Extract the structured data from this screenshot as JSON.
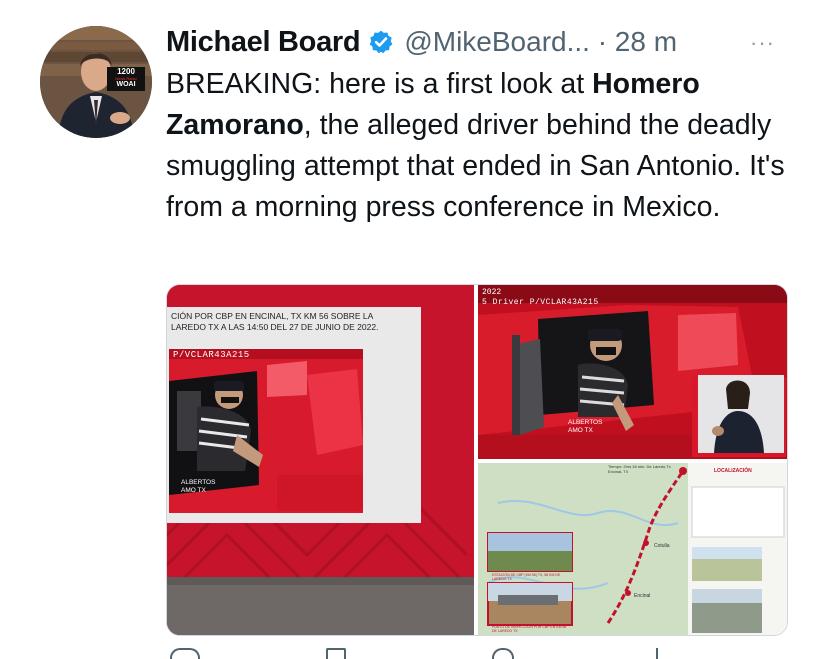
{
  "tweet": {
    "author_name": "Michael Board",
    "handle_time": "@MikeBoard... · 28 m",
    "more_glyph": "···",
    "text_part1": "BREAKING: here is a first look at ",
    "text_bold1": "Homero Zamorano",
    "text_part2": ", the alleged driver behind the deadly smuggling attempt that ended in San Antonio. It's from a morning press conference in Mexico."
  },
  "avatar": {
    "badge_line1": "1200",
    "badge_line2": "News Radio",
    "badge_line3": "WOAI"
  },
  "media": {
    "image1": {
      "caption_line1": "CIÓN POR CBP EN ENCINAL, TX KM 56 SOBRE LA",
      "caption_line2": "LAREDO TX A LAS 14:50 DEL 27 DE JUNIO DE 2022.",
      "plate_text": "P/VCLAR43A215",
      "door_text": "ALBERTOS",
      "door_text2": "AMO TX"
    },
    "image2": {
      "year_text": "2022",
      "overlay_text": "5 Driver P/VCLAR43A215",
      "door_text": "ALBERTOS",
      "door_text2": "AMO TX"
    },
    "image3": {
      "header_text": "Tiempo: 2hrs 16 min. De Laredo,Tx",
      "header_text2": "Encinal, TX",
      "loc_text": "LOCALIZACIÓN",
      "caption_a": "ESTACIÓN DE CBP (KM 56) TX, 56 KM DE LAREDO TX",
      "caption_b": "PUNTO DE INSPECCIÓN POR CBP EN KM 56 DE LAREDO TX",
      "town_a": "Cotulla",
      "town_b": "Encinal"
    }
  },
  "colors": {
    "text": "#0f1419",
    "secondary": "#536471",
    "verified": "#1d9bf0",
    "brand_red": "#c2122b"
  }
}
